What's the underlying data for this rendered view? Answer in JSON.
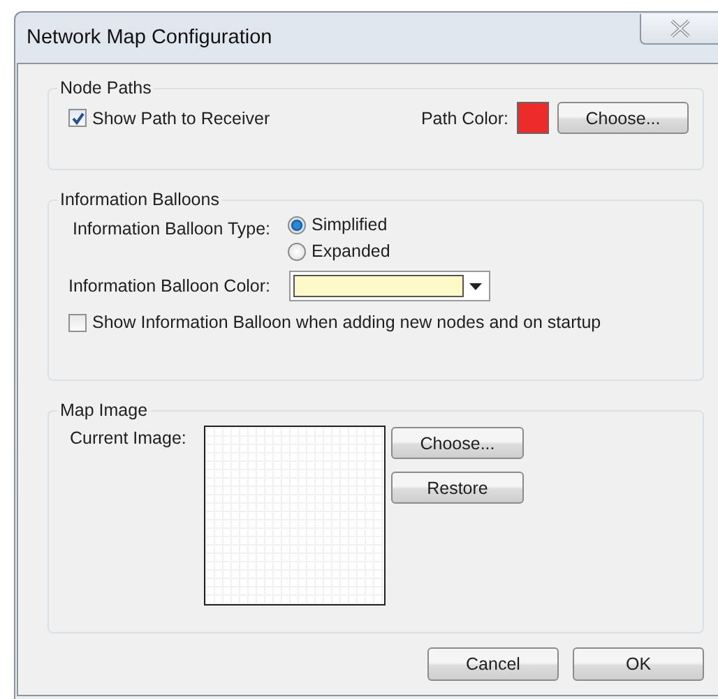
{
  "window": {
    "title": "Network Map Configuration"
  },
  "node_paths": {
    "title": "Node Paths",
    "show_path": {
      "label": "Show Path to Receiver",
      "checked": true
    },
    "path_color": {
      "label": "Path Color:",
      "color": "#ee2b2b"
    },
    "choose_button": "Choose..."
  },
  "information_balloons": {
    "title": "Information Balloons",
    "type_label": "Information Balloon Type:",
    "type_options": [
      {
        "label": "Simplified",
        "selected": true
      },
      {
        "label": "Expanded",
        "selected": false
      }
    ],
    "color_label": "Information Balloon Color:",
    "color": "#fdf9c8",
    "show_on_startup": {
      "label": "Show Information Balloon when adding new nodes and on startup",
      "checked": false
    }
  },
  "map_image": {
    "title": "Map Image",
    "current_label": "Current Image:",
    "buttons": [
      "Choose...",
      "Restore"
    ]
  },
  "buttons": [
    "Cancel",
    "OK"
  ]
}
